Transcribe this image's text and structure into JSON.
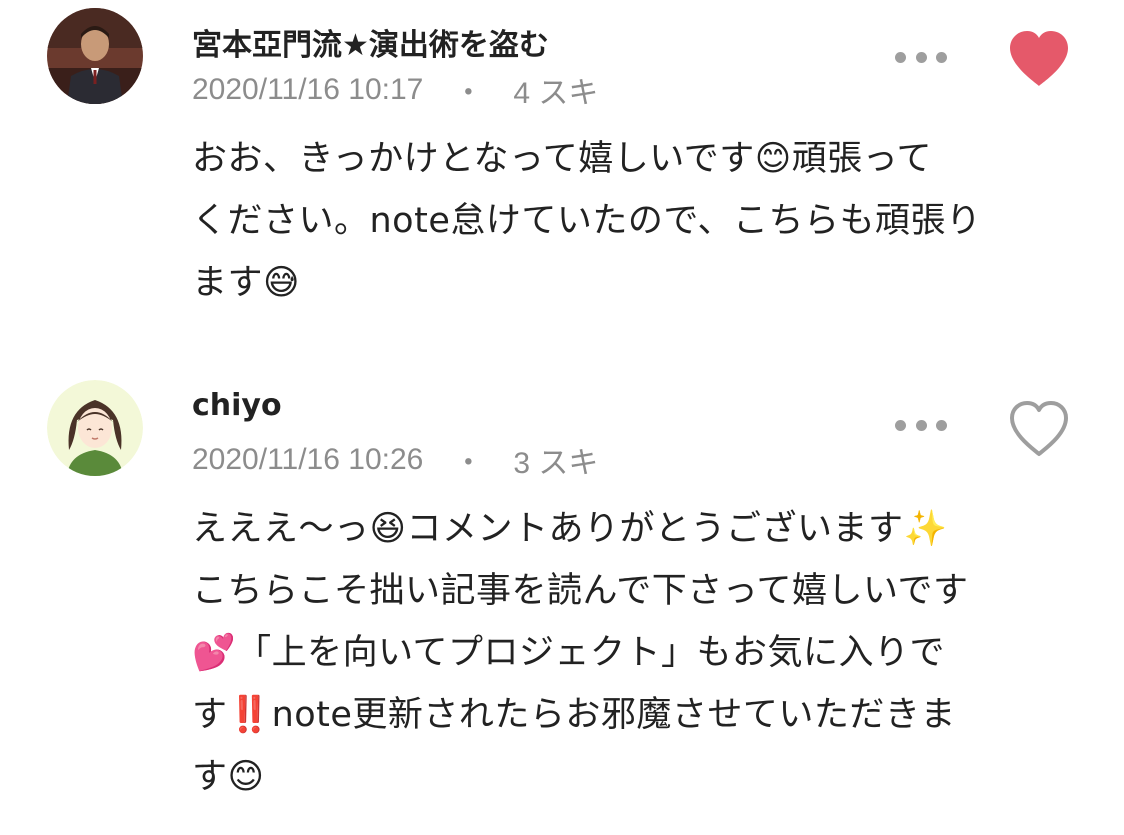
{
  "comments": [
    {
      "author": "宮本亞門流★演出術を盗む",
      "date": "2020/11/16 10:17",
      "separator": "・",
      "likes": "4 スキ",
      "liked": true,
      "text": "おお、きっかけとなって嬉しいです😊頑張って\nください。note怠けていたので、こちらも頑張り\nます😅",
      "avatar": "man-in-suit-photo",
      "icons": {
        "more": "more-dots-icon",
        "like": "heart-filled-icon"
      },
      "colors": {
        "heart": "#e5596a"
      }
    },
    {
      "author": "chiyo",
      "date": "2020/11/16 10:26",
      "separator": "・",
      "likes": "3 スキ",
      "liked": false,
      "text": "えええ〜っ😆コメントありがとうございます✨\nこちらこそ拙い記事を読んで下さって嬉しいです\n💕「上を向いてプロジェクト」もお気に入りで\nす‼️note更新されたらお邪魔させていただきま\nす😊",
      "avatar": "illustrated-woman-avatar",
      "icons": {
        "more": "more-dots-icon",
        "like": "heart-outline-icon"
      },
      "colors": {
        "heart": "#9e9e9e"
      }
    }
  ],
  "colors": {
    "text": "#222222",
    "meta": "#8c8c8c",
    "background": "#ffffff"
  }
}
